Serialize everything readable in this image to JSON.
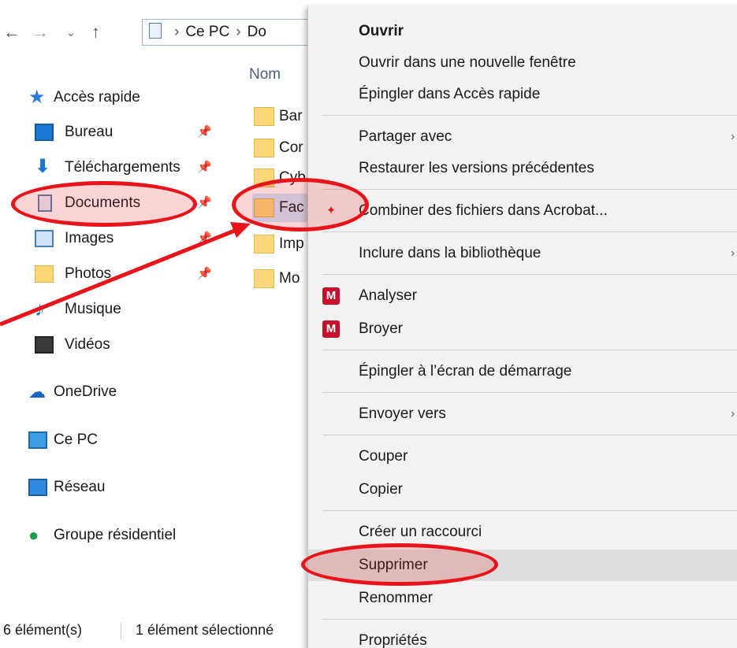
{
  "address_bar": {
    "back_icon": "arrow-left-icon",
    "forward_icon": "arrow-right-icon",
    "history_icon": "chevron-down-icon",
    "up_icon": "arrow-up-icon",
    "crumb_1": "Ce PC",
    "crumb_2": "Do"
  },
  "sidebar": {
    "items": [
      {
        "label": "Accès rapide",
        "icon": "star-icon"
      },
      {
        "label": "Bureau",
        "icon": "desktop-icon"
      },
      {
        "label": "Téléchargements",
        "icon": "download-icon"
      },
      {
        "label": "Documents",
        "icon": "documents-icon"
      },
      {
        "label": "Images",
        "icon": "images-icon"
      },
      {
        "label": "Photos",
        "icon": "folder-icon"
      },
      {
        "label": "Musique",
        "icon": "music-icon"
      },
      {
        "label": "Vidéos",
        "icon": "video-icon"
      },
      {
        "label": "OneDrive",
        "icon": "cloud-icon"
      },
      {
        "label": "Ce PC",
        "icon": "computer-icon"
      },
      {
        "label": "Réseau",
        "icon": "network-icon"
      },
      {
        "label": "Groupe résidentiel",
        "icon": "homegroup-icon"
      }
    ]
  },
  "file_list": {
    "column_name": "Nom",
    "rows": [
      "Bar",
      "Cor",
      "Cyb",
      "Fac",
      "Imp",
      "Mo"
    ]
  },
  "status_bar": {
    "count": "6 élément(s)",
    "selected": "1 élément sélectionné"
  },
  "context_menu": {
    "items": [
      "Ouvrir",
      "Ouvrir dans une nouvelle fenêtre",
      "Épingler dans Accès rapide",
      "Partager avec",
      "Restaurer les versions précédentes",
      "Combiner des fichiers dans Acrobat...",
      "Inclure dans la bibliothèque",
      "Analyser",
      "Broyer",
      "Épingler à l’écran de démarrage",
      "Envoyer vers",
      "Couper",
      "Copier",
      "Créer un raccourci",
      "Supprimer",
      "Renommer",
      "Propriétés"
    ],
    "submenu_arrow": "›",
    "acrobat_icon": "acrobat-icon",
    "mcafee_icon": "mcafee-shield-icon"
  },
  "colors": {
    "annotation_red": "#e8141a",
    "background_blue": "#1f86c8",
    "selection_blue": "#cce8ff"
  }
}
